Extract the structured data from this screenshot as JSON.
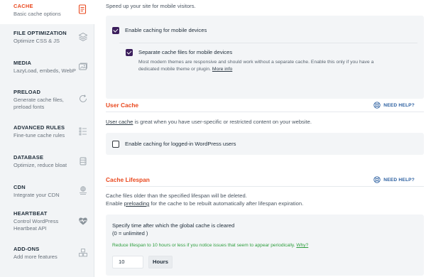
{
  "sidebar": {
    "items": [
      {
        "title": "CACHE",
        "sub": "Basic cache options",
        "icon": "document-icon",
        "active": true
      },
      {
        "title": "FILE OPTIMIZATION",
        "sub": "Optimize CSS & JS",
        "icon": "layers-icon"
      },
      {
        "title": "MEDIA",
        "sub": "LazyLoad, embeds, WebP",
        "icon": "image-icon"
      },
      {
        "title": "PRELOAD",
        "sub": "Generate cache files,\npreload fonts",
        "icon": "refresh-icon"
      },
      {
        "title": "ADVANCED RULES",
        "sub": "Fine-tune cache rules",
        "icon": "list-icon"
      },
      {
        "title": "DATABASE",
        "sub": "Optimize, reduce bloat",
        "icon": "database-icon"
      },
      {
        "title": "CDN",
        "sub": "Integrate your CDN",
        "icon": "cdn-icon"
      },
      {
        "title": "HEARTBEAT",
        "sub": "Control WordPress\nHeartbeat API",
        "icon": "heart-pulse-icon"
      },
      {
        "title": "ADD-ONS",
        "sub": "Add more features",
        "icon": "addons-icon"
      }
    ]
  },
  "mobile": {
    "intro": "Speed up your site for mobile visitors.",
    "enable_label": "Enable caching for mobile devices",
    "separate_label": "Separate cache files for mobile devices",
    "separate_desc_1": "Most modern themes are responsive and should work without a separate cache. Enable this only if you have a",
    "separate_desc_2": "dedicated mobile theme or plugin.",
    "more_info": "More info"
  },
  "user_cache": {
    "title": "User Cache",
    "help": "NEED HELP?",
    "desc_link": "User cache",
    "desc_rest": " is great when you have user-specific or restricted content on your website.",
    "enable_label": "Enable caching for logged-in WordPress users"
  },
  "lifespan": {
    "title": "Cache Lifespan",
    "help": "NEED HELP?",
    "desc_1": "Cache files older than the specified lifespan will be deleted.",
    "desc_2_pre": "Enable ",
    "desc_2_link": "preloading",
    "desc_2_post": " for the cache to be rebuilt automatically after lifespan expiration.",
    "field_label_1": "Specify time after which the global cache is cleared",
    "field_label_2": "(0 = unlimited )",
    "hint": "Reduce lifespan to 10 hours or less if you notice issues that seem to appear periodically.",
    "hint_link": "Why?",
    "value": "10",
    "unit": "Hours"
  },
  "colors": {
    "accent": "#e9481e",
    "checkbox": "#3b1e5c",
    "help": "#2b5fa0",
    "hint": "#2e9e3e"
  }
}
